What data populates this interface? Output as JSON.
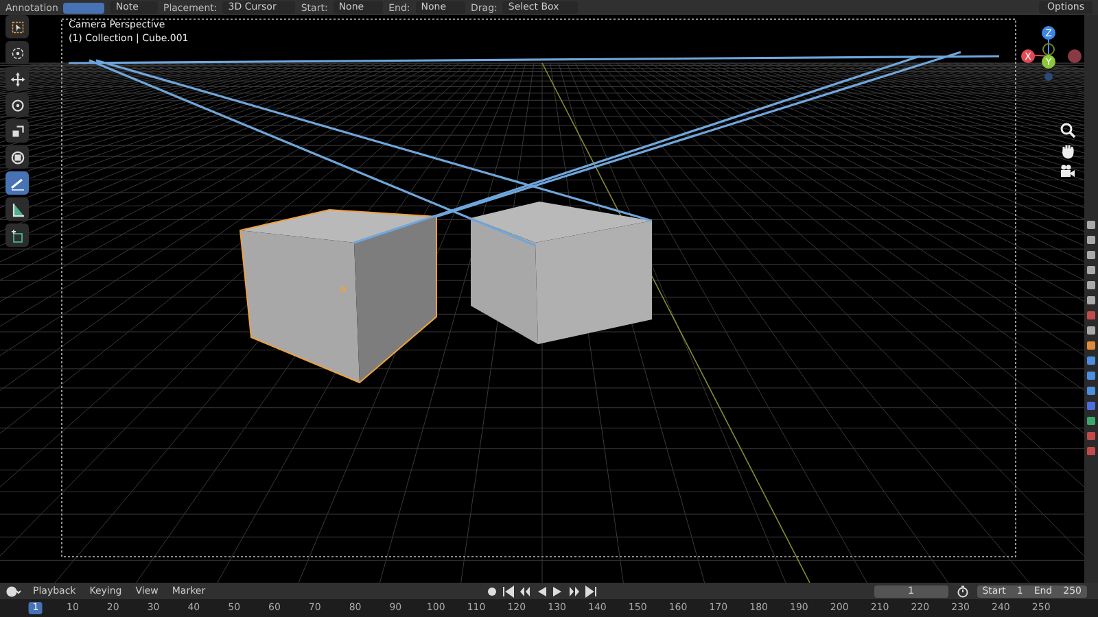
{
  "header": {
    "items": [
      {
        "kind": "label",
        "text": "Annotation"
      },
      {
        "kind": "swatch"
      },
      {
        "kind": "dropdown",
        "text": "Note"
      },
      {
        "kind": "label",
        "text": "Placement:"
      },
      {
        "kind": "dropdown",
        "text": "3D Cursor"
      },
      {
        "kind": "label",
        "text": "Start:"
      },
      {
        "kind": "dropdown",
        "text": "None"
      },
      {
        "kind": "label",
        "text": "End:"
      },
      {
        "kind": "dropdown",
        "text": "None"
      },
      {
        "kind": "label",
        "text": "Drag:"
      },
      {
        "kind": "dropdown",
        "text": "Select Box"
      }
    ],
    "options": "Options"
  },
  "viewport": {
    "title": "Camera Perspective",
    "subtitle": "(1) Collection | Cube.001",
    "tools": [
      {
        "kind": "select",
        "selected": false
      },
      {
        "kind": "cursor",
        "selected": false
      },
      {
        "kind": "move",
        "selected": false
      },
      {
        "kind": "rotate",
        "selected": false
      },
      {
        "kind": "scale",
        "selected": false
      },
      {
        "kind": "transform",
        "selected": false
      },
      {
        "kind": "annotate",
        "selected": true
      },
      {
        "kind": "measure",
        "selected": false
      },
      {
        "kind": "add",
        "selected": false
      }
    ],
    "gizmo": {
      "z": "Z",
      "y": "Y",
      "x": "X"
    },
    "objects": [
      {
        "selected": true
      },
      {
        "selected": false
      }
    ]
  },
  "properties_tabs": [
    {
      "color": "#aaaaaa"
    },
    {
      "color": "#aaaaaa"
    },
    {
      "color": "#aaaaaa"
    },
    {
      "color": "#aaaaaa"
    },
    {
      "color": "#aaaaaa"
    },
    {
      "color": "#aaaaaa"
    },
    {
      "color": "#c24a4a"
    },
    {
      "color": "#aaaaaa"
    },
    {
      "color": "#e08a3a"
    },
    {
      "color": "#4a8fe0"
    },
    {
      "color": "#4a8fe0"
    },
    {
      "color": "#4a8fe0"
    },
    {
      "color": "#4a6fe0"
    },
    {
      "color": "#3aa86a"
    },
    {
      "color": "#c24a4a"
    },
    {
      "color": "#c24a4a"
    }
  ],
  "timeline": {
    "menus": [
      "Playback",
      "Keying",
      "View",
      "Marker"
    ],
    "current_frame": "1",
    "start_label": "Start",
    "start": "1",
    "end_label": "End",
    "end": "250",
    "ruler": [
      {
        "label": "1",
        "selected": true
      },
      {
        "label": "10",
        "selected": false
      },
      {
        "label": "20",
        "selected": false
      },
      {
        "label": "30",
        "selected": false
      },
      {
        "label": "40",
        "selected": false
      },
      {
        "label": "50",
        "selected": false
      },
      {
        "label": "60",
        "selected": false
      },
      {
        "label": "70",
        "selected": false
      },
      {
        "label": "80",
        "selected": false
      },
      {
        "label": "90",
        "selected": false
      },
      {
        "label": "100",
        "selected": false
      },
      {
        "label": "110",
        "selected": false
      },
      {
        "label": "120",
        "selected": false
      },
      {
        "label": "130",
        "selected": false
      },
      {
        "label": "140",
        "selected": false
      },
      {
        "label": "150",
        "selected": false
      },
      {
        "label": "160",
        "selected": false
      },
      {
        "label": "170",
        "selected": false
      },
      {
        "label": "180",
        "selected": false
      },
      {
        "label": "190",
        "selected": false
      },
      {
        "label": "200",
        "selected": false
      },
      {
        "label": "210",
        "selected": false
      },
      {
        "label": "220",
        "selected": false
      },
      {
        "label": "230",
        "selected": false
      },
      {
        "label": "240",
        "selected": false
      },
      {
        "label": "250",
        "selected": false
      }
    ]
  }
}
